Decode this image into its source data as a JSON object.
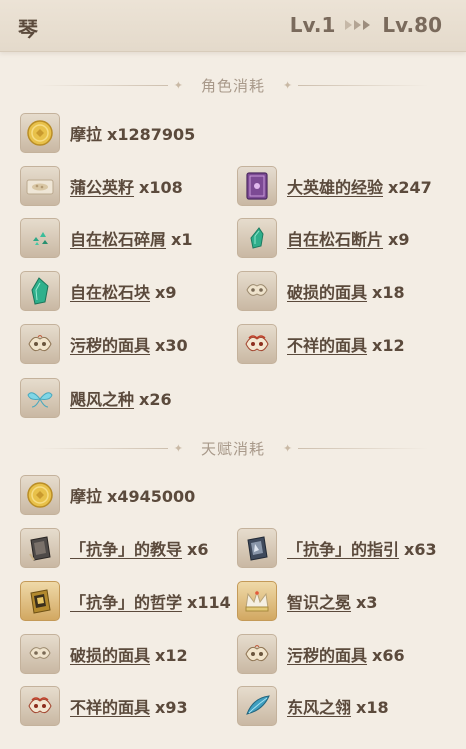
{
  "header": {
    "character": "琴",
    "level_from": "Lv.1",
    "level_to": "Lv.80"
  },
  "sections": {
    "character": {
      "title": "角色消耗"
    },
    "talent": {
      "title": "天赋消耗"
    }
  },
  "char_items": [
    {
      "name": "摩拉",
      "qty": "x1287905",
      "icon": "mora-coin-icon"
    },
    {
      "name": "蒲公英籽",
      "qty": "x108",
      "icon": "dandelion-seed-icon"
    },
    {
      "name": "大英雄的经验",
      "qty": "x247",
      "icon": "heros-wit-book-icon"
    },
    {
      "name": "自在松石碎屑",
      "qty": "x1",
      "icon": "turquoise-sliver-icon"
    },
    {
      "name": "自在松石断片",
      "qty": "x9",
      "icon": "turquoise-fragment-icon"
    },
    {
      "name": "自在松石块",
      "qty": "x9",
      "icon": "turquoise-chunk-icon"
    },
    {
      "name": "破损的面具",
      "qty": "x18",
      "icon": "damaged-mask-icon"
    },
    {
      "name": "污秽的面具",
      "qty": "x30",
      "icon": "stained-mask-icon"
    },
    {
      "name": "不祥的面具",
      "qty": "x12",
      "icon": "ominous-mask-icon"
    },
    {
      "name": "飓风之种",
      "qty": "x26",
      "icon": "hurricane-seed-icon"
    }
  ],
  "talent_items": [
    {
      "name": "摩拉",
      "qty": "x4945000",
      "icon": "mora-coin-icon"
    },
    {
      "name": "「抗争」的教导",
      "qty": "x6",
      "icon": "resistance-teachings-icon"
    },
    {
      "name": "「抗争」的指引",
      "qty": "x63",
      "icon": "resistance-guide-icon"
    },
    {
      "name": "「抗争」的哲学",
      "qty": "x114",
      "icon": "resistance-philosophies-icon"
    },
    {
      "name": "智识之冕",
      "qty": "x3",
      "icon": "crown-of-insight-icon"
    },
    {
      "name": "破损的面具",
      "qty": "x12",
      "icon": "damaged-mask-icon"
    },
    {
      "name": "污秽的面具",
      "qty": "x66",
      "icon": "stained-mask-icon"
    },
    {
      "name": "不祥的面具",
      "qty": "x93",
      "icon": "ominous-mask-icon"
    },
    {
      "name": "东风之翎",
      "qty": "x18",
      "icon": "dvalin-plume-icon"
    }
  ]
}
